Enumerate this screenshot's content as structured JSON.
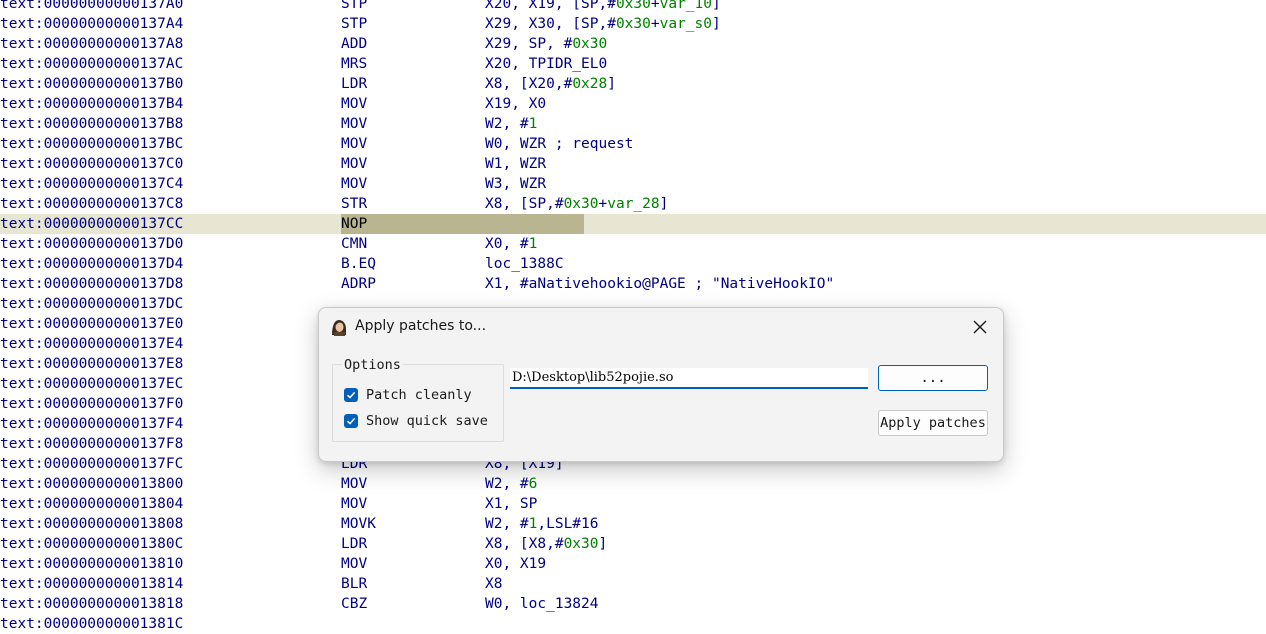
{
  "listing": {
    "lines": [
      {
        "address": "text:00000000000137A0",
        "mnemonic": "STP",
        "operands": [
          {
            "t": "X20, X19, [SP,#"
          },
          {
            "t": "0x30",
            "c": "num"
          },
          {
            "t": "+"
          },
          {
            "t": "var_10",
            "c": "var"
          },
          {
            "t": "]"
          }
        ]
      },
      {
        "address": "text:00000000000137A4",
        "mnemonic": "STP",
        "operands": [
          {
            "t": "X29, X30, [SP,#"
          },
          {
            "t": "0x30",
            "c": "num"
          },
          {
            "t": "+"
          },
          {
            "t": "var_s0",
            "c": "var"
          },
          {
            "t": "]"
          }
        ]
      },
      {
        "address": "text:00000000000137A8",
        "mnemonic": "ADD",
        "operands": [
          {
            "t": "X29, SP, #"
          },
          {
            "t": "0x30",
            "c": "num"
          }
        ]
      },
      {
        "address": "text:00000000000137AC",
        "mnemonic": "MRS",
        "operands": [
          {
            "t": "X20, TPIDR_EL0"
          }
        ]
      },
      {
        "address": "text:00000000000137B0",
        "mnemonic": "LDR",
        "operands": [
          {
            "t": "X8, [X20,#"
          },
          {
            "t": "0x28",
            "c": "num"
          },
          {
            "t": "]"
          }
        ]
      },
      {
        "address": "text:00000000000137B4",
        "mnemonic": "MOV",
        "operands": [
          {
            "t": "X19, X0"
          }
        ]
      },
      {
        "address": "text:00000000000137B8",
        "mnemonic": "MOV",
        "operands": [
          {
            "t": "W2, #"
          },
          {
            "t": "1",
            "c": "num"
          }
        ]
      },
      {
        "address": "text:00000000000137BC",
        "mnemonic": "MOV",
        "operands": [
          {
            "t": "W0, WZR "
          },
          {
            "t": "; request",
            "c": "cmt"
          }
        ]
      },
      {
        "address": "text:00000000000137C0",
        "mnemonic": "MOV",
        "operands": [
          {
            "t": "W1, WZR"
          }
        ]
      },
      {
        "address": "text:00000000000137C4",
        "mnemonic": "MOV",
        "operands": [
          {
            "t": "W3, WZR"
          }
        ]
      },
      {
        "address": "text:00000000000137C8",
        "mnemonic": "STR",
        "operands": [
          {
            "t": "X8, [SP,#"
          },
          {
            "t": "0x30",
            "c": "num"
          },
          {
            "t": "+"
          },
          {
            "t": "var_28",
            "c": "var"
          },
          {
            "t": "]"
          }
        ]
      },
      {
        "address": "text:00000000000137CC",
        "mnemonic": "NOP",
        "operands": [],
        "current": true
      },
      {
        "address": "text:00000000000137D0",
        "mnemonic": "CMN",
        "operands": [
          {
            "t": "X0, #"
          },
          {
            "t": "1",
            "c": "num"
          }
        ]
      },
      {
        "address": "text:00000000000137D4",
        "mnemonic": "B.EQ",
        "operands": [
          {
            "t": "loc_1388C"
          }
        ]
      },
      {
        "address": "text:00000000000137D8",
        "mnemonic": "ADRP",
        "operands": [
          {
            "t": "X1, #aNativehookio@PAGE "
          },
          {
            "t": "; \"NativeHookIO\"",
            "c": "cmt"
          }
        ]
      },
      {
        "address": "text:00000000000137DC",
        "mnemonic": "",
        "operands": []
      },
      {
        "address": "text:00000000000137E0",
        "mnemonic": "",
        "operands": []
      },
      {
        "address": "text:00000000000137E4",
        "mnemonic": "",
        "operands": []
      },
      {
        "address": "text:00000000000137E8",
        "mnemonic": "",
        "operands": []
      },
      {
        "address": "text:00000000000137EC",
        "mnemonic": "",
        "operands": []
      },
      {
        "address": "text:00000000000137F0",
        "mnemonic": "",
        "operands": []
      },
      {
        "address": "text:00000000000137F4",
        "mnemonic": "",
        "operands": []
      },
      {
        "address": "text:00000000000137F8",
        "mnemonic": "",
        "operands": []
      },
      {
        "address": "text:00000000000137FC",
        "mnemonic": "LDR",
        "operands": [
          {
            "t": "X8, [X19]"
          }
        ]
      },
      {
        "address": "text:0000000000013800",
        "mnemonic": "MOV",
        "operands": [
          {
            "t": "W2, #"
          },
          {
            "t": "6",
            "c": "num"
          }
        ]
      },
      {
        "address": "text:0000000000013804",
        "mnemonic": "MOV",
        "operands": [
          {
            "t": "X1, SP"
          }
        ]
      },
      {
        "address": "text:0000000000013808",
        "mnemonic": "MOVK",
        "operands": [
          {
            "t": "W2, #"
          },
          {
            "t": "1",
            "c": "num"
          },
          {
            "t": ",LSL#16"
          }
        ]
      },
      {
        "address": "text:000000000001380C",
        "mnemonic": "LDR",
        "operands": [
          {
            "t": "X8, [X8,#"
          },
          {
            "t": "0x30",
            "c": "num"
          },
          {
            "t": "]"
          }
        ]
      },
      {
        "address": "text:0000000000013810",
        "mnemonic": "MOV",
        "operands": [
          {
            "t": "X0, X19"
          }
        ]
      },
      {
        "address": "text:0000000000013814",
        "mnemonic": "BLR",
        "operands": [
          {
            "t": "X8"
          }
        ]
      },
      {
        "address": "text:0000000000013818",
        "mnemonic": "CBZ",
        "operands": [
          {
            "t": "W0, loc_13824"
          }
        ]
      },
      {
        "address": "text:000000000001381C",
        "mnemonic": "",
        "operands": []
      }
    ]
  },
  "dialog": {
    "title": "Apply patches to...",
    "app_icon": "ida-portrait-icon",
    "close_icon": "close-icon",
    "options": {
      "legend": "Options",
      "patch_cleanly": {
        "label": "Patch cleanly",
        "checked": true
      },
      "show_quick_save": {
        "label": "Show quick save",
        "checked": true
      }
    },
    "path_value": "D:\\Desktop\\lib52pojie.so",
    "browse_label": "...",
    "apply_label": "Apply patches"
  },
  "colors": {
    "address": "#000080",
    "number": "#008000",
    "current_line": "#e6e6d3",
    "current_mnemonic": "#b9b591",
    "accent": "#005fb8"
  }
}
